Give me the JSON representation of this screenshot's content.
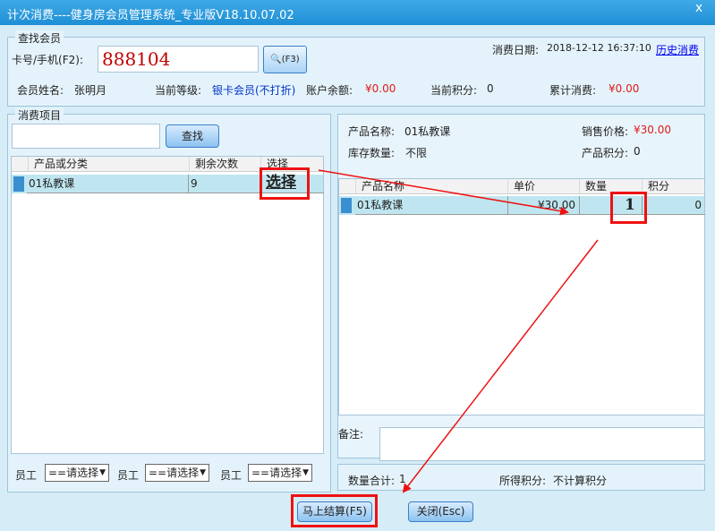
{
  "window": {
    "title": "计次消费----健身房会员管理系统_专业版V18.10.07.02",
    "close": "x"
  },
  "member_search": {
    "legend": "查找会员",
    "card_label": "卡号/手机(F2):",
    "card_value": "888104",
    "search_button": "(F3)",
    "date_label": "消费日期:",
    "date_value": "2018-12-12 16:37:10",
    "history_link": "历史消费",
    "name_label": "会员姓名:",
    "name_value": "张明月",
    "level_label": "当前等级:",
    "level_value": "银卡会员(不打折)",
    "balance_label": "账户余额:",
    "balance_value": "¥0.00",
    "points_label": "当前积分:",
    "points_value": "0",
    "total_label": "累计消费:",
    "total_value": "¥0.00"
  },
  "items": {
    "legend": "消费项目",
    "find_button": "查找",
    "columns": [
      "产品或分类",
      "剩余次数",
      "选择"
    ],
    "rows": [
      {
        "name": "01私教课",
        "remaining": "9",
        "select": "选择"
      }
    ]
  },
  "product": {
    "name_label": "产品名称:",
    "name_value": "01私教课",
    "price_label": "销售价格:",
    "price_value": "¥30.00",
    "stock_label": "库存数量:",
    "stock_value": "不限",
    "points_label": "产品积分:",
    "points_value": "0"
  },
  "cart": {
    "columns": [
      "产品名称",
      "单价",
      "数量",
      "积分"
    ],
    "rows": [
      {
        "name": "01私教课",
        "price": "¥30.00",
        "qty": "1",
        "points": "0"
      }
    ]
  },
  "staff": {
    "label": "员工",
    "placeholder": "==请选择"
  },
  "remark_label": "备注:",
  "summary": {
    "qty_label": "数量合计:",
    "qty_value": "1",
    "points_label": "所得积分:",
    "points_value": "不计算积分"
  },
  "footer": {
    "checkout": "马上结算(F5)",
    "close": "关闭(Esc)"
  },
  "colors": {
    "title_bar": "#1e8fd6",
    "highlight": "#ee1111",
    "price": "#e01b1b"
  }
}
